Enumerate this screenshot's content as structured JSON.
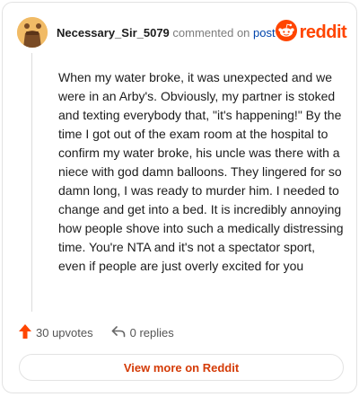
{
  "header": {
    "username": "Necessary_Sir_5079",
    "commented_on": "commented on",
    "post_link": "post",
    "brand": "reddit"
  },
  "comment": {
    "body": "When my water broke, it was unexpected and we were in an Arby's. Obviously, my partner is stoked and texting everybody that, \"it's happening!\" By the time I got out of the exam room at the hospital to confirm my water broke, his uncle was there with a niece with god damn balloons. They lingered for so damn long, I was ready to murder him. I needed to change and get into a bed. It is incredibly annoying how people shove into such a medically distressing time. You're NTA and it's not a spectator sport, even if people are just overly excited for you"
  },
  "actions": {
    "upvotes": "30 upvotes",
    "replies": "0 replies"
  },
  "view_more": "View more on Reddit",
  "icons": {
    "avatar": "user-avatar",
    "logo": "reddit-logo-icon",
    "upvote": "upvote-arrow-icon",
    "reply": "reply-arrow-icon"
  },
  "colors": {
    "brand": "#ff4500",
    "link": "#0045ac",
    "view_more": "#d43b07",
    "upvote": "#ff4500"
  }
}
